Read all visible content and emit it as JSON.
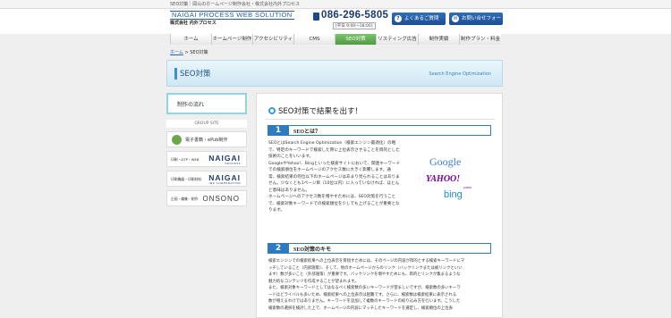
{
  "topbar": {
    "text": "SEO対策｜岡山のホームページ制作会社・株式会社内外プロセス"
  },
  "header": {
    "logo_en": "NAIGAI PROCESS WEB SOLUTION",
    "logo_jp": "株式会社 内外プロセス",
    "tel": "086-296-5805",
    "hours": "[平日 9:00〜18:00]",
    "faq_label": "よくあるご質問",
    "contact_label": "お問い合せフォーム"
  },
  "nav": [
    "ホーム",
    "ホームページ制作",
    "アクセシビリティ",
    "CMS",
    "SEO対策",
    "リスティング広告",
    "制作実績",
    "制作プラン・料金"
  ],
  "nav_active": "SEO対策",
  "breadcrumb": {
    "home": "ホーム",
    "sep": ">",
    "current": "SEO対策"
  },
  "banner": {
    "title": "SEO対策",
    "subtitle": "Search Engine Optimization"
  },
  "sidebar": {
    "flow": "制作の流れ",
    "flow_arrows": "›››",
    "group": "GROUP SITE",
    "items": [
      {
        "label": "電子書籍・ePub制作"
      },
      {
        "small": "印刷・DTP・WEB",
        "brand": "NAIGAI",
        "sub": "PROCESS"
      },
      {
        "small": "印刷機器・印刷材料",
        "brand": "NAIGAI",
        "sub": "INK CORPORATION"
      },
      {
        "small": "企画・編集・制作",
        "brand": "ONSONO"
      }
    ]
  },
  "main": {
    "title": "SEO対策で結果を出す！",
    "sec1_num": "1",
    "sec1_title": "SEOとは？",
    "sec1_lines": [
      "SEOとはSearch Engine Optimization（検索エンジン最適化）の略",
      "で、特定のキーワードで検索した際に上位表示させることを目的とした",
      "技術のことをいいます。",
      "GoogleやYahoo!、Bingといった検索サイトにおいて、関連キーワード",
      "での検索順位をホームページのアクセス数に大きく影響します。通",
      "常、検索結果の何位以下のホームページはあまり見られることはありま",
      "せん。少なくとも1ページ目（10位以内）に入っていなければ、ほとん",
      "ど意味はありません。",
      "ホームページへのアクセス数を増やすためには、SEO対策を行うこと",
      "で、検索対象キーワードでの検索順位を少しでも上げることが重要とな",
      "ります。"
    ],
    "logos": {
      "google": "Google",
      "yahoo": "YAHOO!",
      "yahoo_sub": "JAPAN",
      "bing": "bing"
    },
    "sec2_num": "2",
    "sec2_title": "SEO対策のキモ",
    "sec2_lines": [
      "検索エンジンでの検索結果への上位表示を目指すためには、そのページの内容が目的とする検索キーワードにマ",
      "ッチしていること（内部施策）、そして、他のホームページからのリンク（バックリンクまたは被リンクといい",
      "ます）数が多いこと（外部施策）が重要です。バックリンクを増やすためにも、目的とリンクが集まるような",
      "魅力的なコンテンツを作成することが望まれます。",
      "また、検索対象キーワードとしてはなるべく検索数の多いキーワードが望ましいですが、検索数の多いキーワ",
      "ードほどライバルも多いため、検索結果への上位表示は困難です。さらに、検索数は検索結果に表示される",
      "数が増えるわけではありません。キーワードを追加して複数のキーワードの絞り込み方を行います。こうした",
      "検索数の選択を検討した上で、ホームページの内容にマッチしたキーワードを選定し、検索順位の上位表"
    ]
  },
  "colors": {
    "accent_blue": "#2e7bbf",
    "nav_active_green": "#5aa84b",
    "banner_bg": "#d8eef8"
  }
}
